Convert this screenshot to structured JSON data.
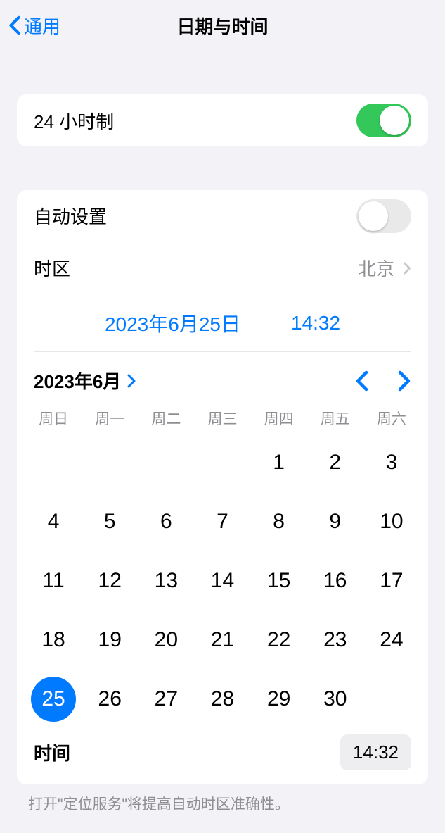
{
  "header": {
    "back_label": "通用",
    "title": "日期与时间"
  },
  "settings": {
    "twentyfour_hour_label": "24 小时制",
    "auto_set_label": "自动设置",
    "timezone_label": "时区",
    "timezone_value": "北京"
  },
  "datetime": {
    "date_display": "2023年6月25日",
    "time_display": "14:32"
  },
  "calendar": {
    "month_heading": "2023年6月",
    "weekdays": [
      "周日",
      "周一",
      "周二",
      "周三",
      "周四",
      "周五",
      "周六"
    ],
    "leading_blanks": 4,
    "days_in_month": 30,
    "selected_day": 25,
    "time_label": "时间",
    "time_value": "14:32"
  },
  "footnote": "打开\"定位服务\"将提高自动时区准确性。"
}
